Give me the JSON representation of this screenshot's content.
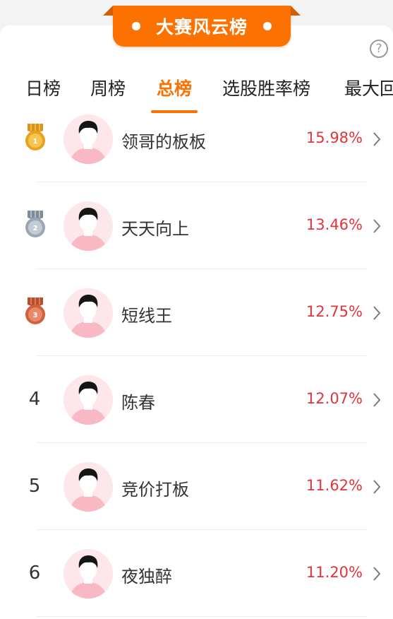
{
  "header": {
    "title": "大赛风云榜",
    "help_icon": "question-circle-icon",
    "help_glyph": "?"
  },
  "tabs": [
    {
      "label": "日榜",
      "active": false
    },
    {
      "label": "周榜",
      "active": false
    },
    {
      "label": "总榜",
      "active": true
    },
    {
      "label": "选股胜率榜",
      "active": false
    },
    {
      "label": "最大回",
      "active": false
    }
  ],
  "rankings": [
    {
      "rank": "1",
      "medal": "gold-medal-icon",
      "name": "领哥的板板",
      "value": "15.98%"
    },
    {
      "rank": "2",
      "medal": "silver-medal-icon",
      "name": "天天向上",
      "value": "13.46%"
    },
    {
      "rank": "3",
      "medal": "bronze-medal-icon",
      "name": "短线王",
      "value": "12.75%"
    },
    {
      "rank": "4",
      "medal": null,
      "name": "陈春",
      "value": "12.07%"
    },
    {
      "rank": "5",
      "medal": null,
      "name": "竞价打板",
      "value": "11.62%"
    },
    {
      "rank": "6",
      "medal": null,
      "name": "夜独醉",
      "value": "11.20%"
    }
  ],
  "colors": {
    "accent": "#fb7102",
    "value_red": "#e2343c",
    "gold": "#e8a21c",
    "silver": "#9aa6b3",
    "bronze": "#d0613a"
  }
}
